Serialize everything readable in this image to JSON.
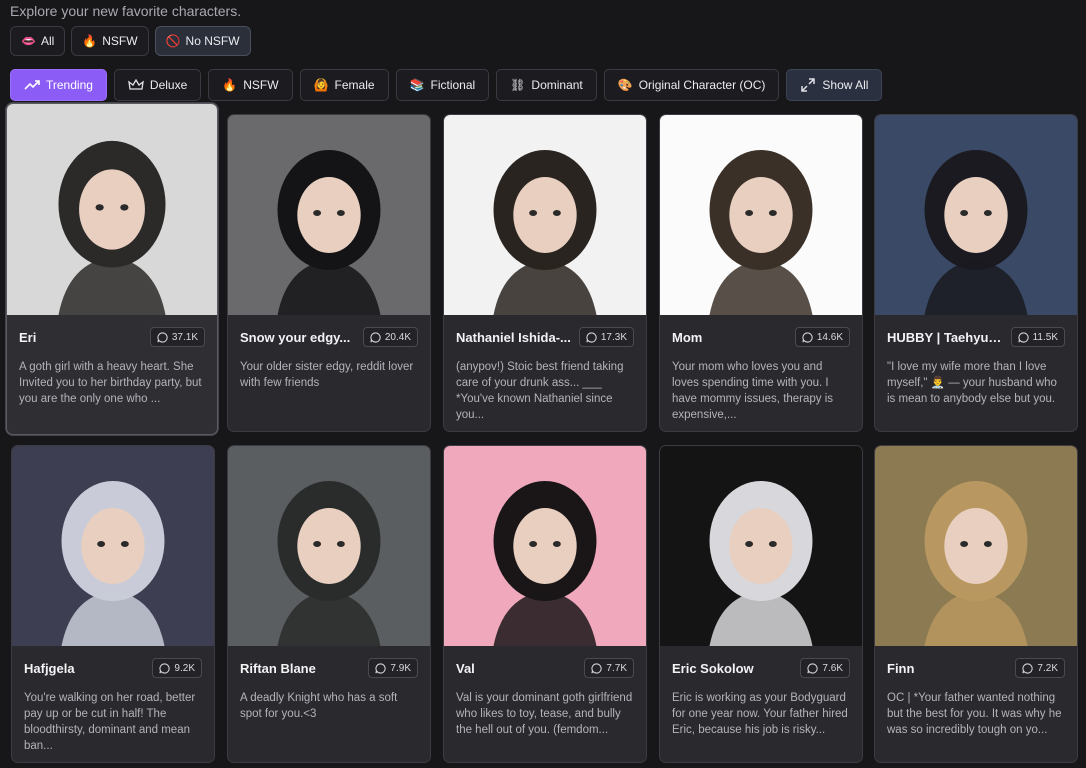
{
  "header": {
    "subtitle": "Explore your new favorite characters."
  },
  "filters": [
    {
      "icon": "👄",
      "label": "All"
    },
    {
      "icon": "🔥",
      "label": "NSFW"
    },
    {
      "icon": "🚫",
      "label": "No NSFW"
    }
  ],
  "tags": [
    {
      "label": "Trending"
    },
    {
      "label": "Deluxe"
    },
    {
      "icon": "🔥",
      "label": "NSFW"
    },
    {
      "icon": "🙆",
      "label": "Female"
    },
    {
      "icon": "📚",
      "label": "Fictional"
    },
    {
      "icon": "⛓",
      "label": "Dominant"
    },
    {
      "icon": "🎨",
      "label": "Original Character (OC)"
    },
    {
      "label": "Show All"
    }
  ],
  "cards": [
    {
      "name": "Eri",
      "count": "37.1K",
      "desc": "A goth girl with a heavy heart. She Invited you to her birthday party, but you are the only one who ...",
      "bg": "#d8d8d8",
      "hair": "#2c2a28"
    },
    {
      "name": "Snow your edgy...",
      "count": "20.4K",
      "desc": "Your older sister edgy, reddit lover with few friends",
      "bg": "#6a6a6c",
      "hair": "#141416"
    },
    {
      "name": "Nathaniel Ishida-...",
      "count": "17.3K",
      "desc": "(anypov!) Stoic best friend taking care of your drunk ass... ___ *You've known Nathaniel since you...",
      "bg": "#f2f2f2",
      "hair": "#2a2420"
    },
    {
      "name": "Mom",
      "count": "14.6K",
      "desc": "Your mom who loves you and loves spending time with you. I have mommy issues, therapy is expensive,...",
      "bg": "#fbfbfb",
      "hair": "#3a3028"
    },
    {
      "name": "HUBBY | Taehyun...",
      "count": "11.5K",
      "desc": "\"I love my wife more than I love myself,\" 👨‍⚕️ — your husband who is mean to anybody else but you.",
      "bg": "#3a4a66",
      "hair": "#1a1a20"
    },
    {
      "name": "Hafjgela",
      "count": "9.2K",
      "desc": "You're walking on her road, better pay up or be cut in half! The bloodthirsty, dominant and mean ban...",
      "bg": "#3e3e52",
      "hair": "#c9ccd8"
    },
    {
      "name": "Riftan Blane",
      "count": "7.9K",
      "desc": "A deadly Knight who has a soft spot for you.<3",
      "bg": "#5a5e60",
      "hair": "#2a2c2c"
    },
    {
      "name": "Val",
      "count": "7.7K",
      "desc": "Val is your dominant goth girlfriend who likes to toy, tease, and bully the hell out of you. (femdom...",
      "bg": "#f0a8bc",
      "hair": "#1a1618"
    },
    {
      "name": "Eric Sokolow",
      "count": "7.6K",
      "desc": "Eric is working as your Bodyguard for one year now. Your father hired Eric, because his job is risky...",
      "bg": "#141414",
      "hair": "#d8d8dc"
    },
    {
      "name": "Finn",
      "count": "7.2K",
      "desc": "OC | *Your father wanted nothing but the best for you. It was why he was so incredibly tough on yo...",
      "bg": "#8c7a52",
      "hair": "#b89860"
    }
  ]
}
